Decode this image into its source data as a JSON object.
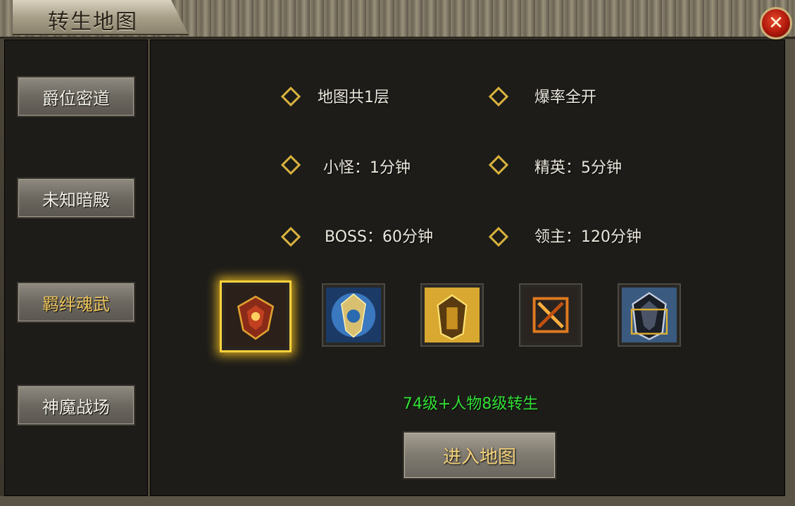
{
  "window": {
    "title": "转生地图",
    "close_label": "✕"
  },
  "sidebar": {
    "items": [
      {
        "label": "爵位密道",
        "active": false
      },
      {
        "label": "未知暗殿",
        "active": false
      },
      {
        "label": "羁绊魂武",
        "active": true
      },
      {
        "label": "神魔战场",
        "active": false
      }
    ]
  },
  "info": {
    "floors": "地图共1层",
    "drop_rate": "爆率全开",
    "minion": "小怪：1分钟",
    "elite": "精英：5分钟",
    "boss": "BOSS：60分钟",
    "lord": "领主：120分钟"
  },
  "items": [
    {
      "icon": "dragon-crest-icon",
      "selected": true
    },
    {
      "icon": "blue-armor-icon",
      "selected": false
    },
    {
      "icon": "gold-armor-icon",
      "selected": false
    },
    {
      "icon": "fire-rune-icon",
      "selected": false
    },
    {
      "icon": "dark-armor-icon",
      "selected": false
    }
  ],
  "requirement": "74级+人物8级转生",
  "enter_button": "进入地图",
  "colors": {
    "accent_gold": "#d8b23e",
    "requirement_green": "#33e036",
    "close_red": "#c0200e"
  }
}
